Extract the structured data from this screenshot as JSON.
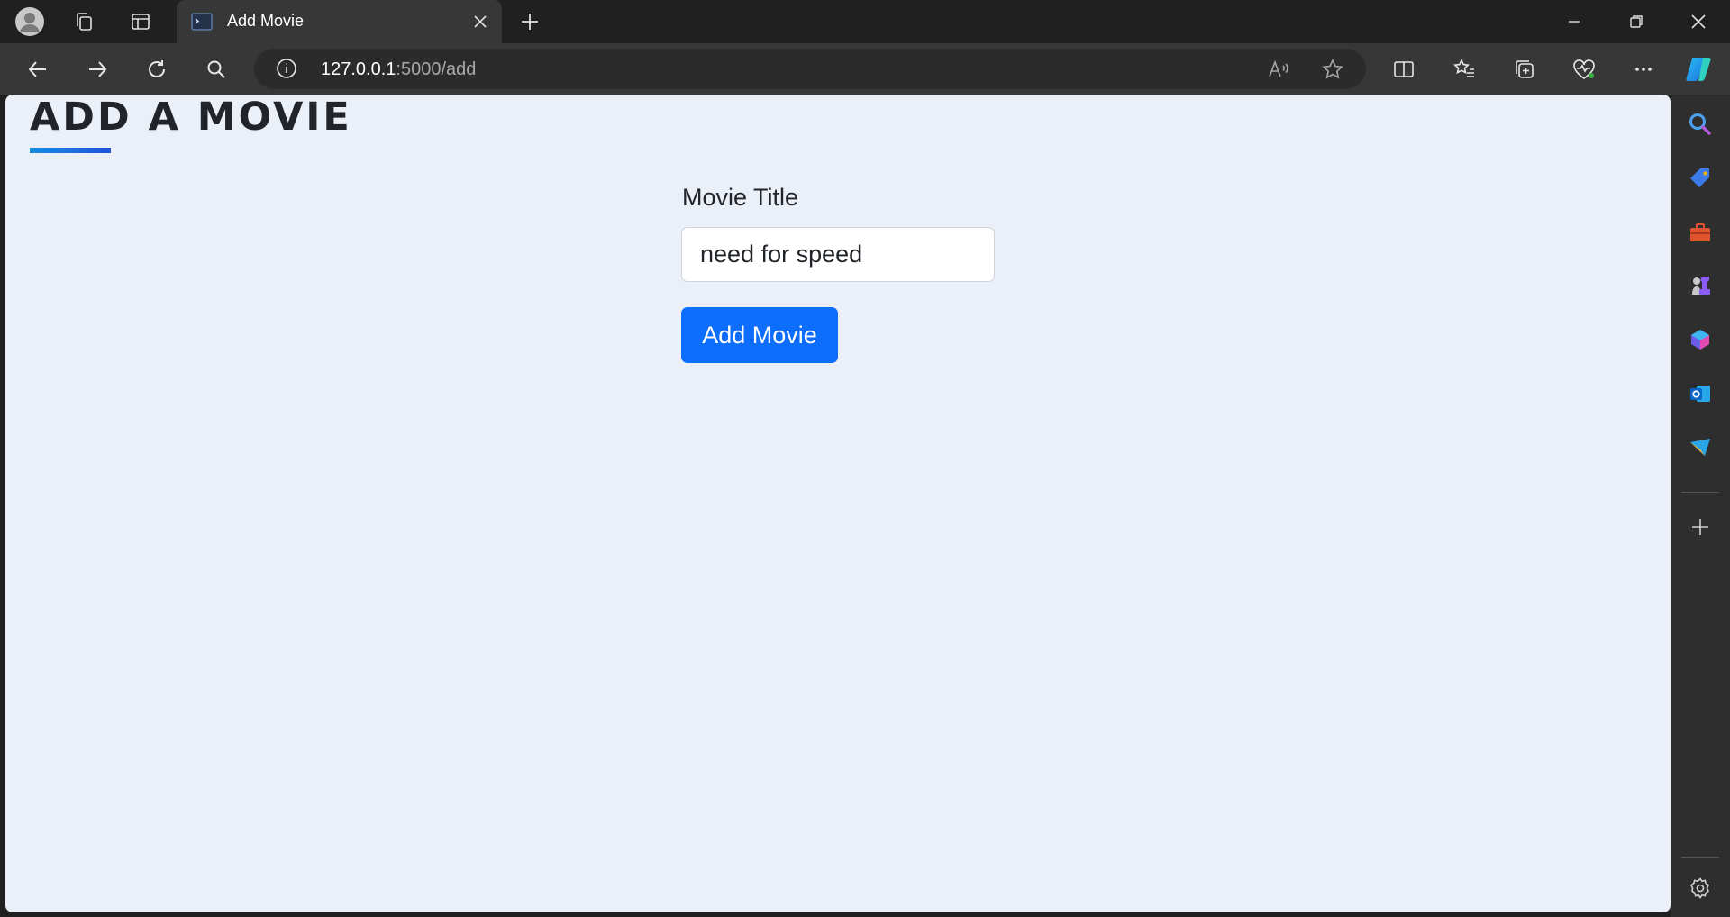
{
  "browser": {
    "tab_title": "Add Movie",
    "url_host": "127.0.0.1",
    "url_rest": ":5000/add"
  },
  "page": {
    "heading": "ADD A MOVIE",
    "form": {
      "title_label": "Movie Title",
      "title_value": "need for speed",
      "submit_label": "Add Movie"
    }
  },
  "colors": {
    "accent": "#0d6efd",
    "page_background": "#eaeff8"
  }
}
